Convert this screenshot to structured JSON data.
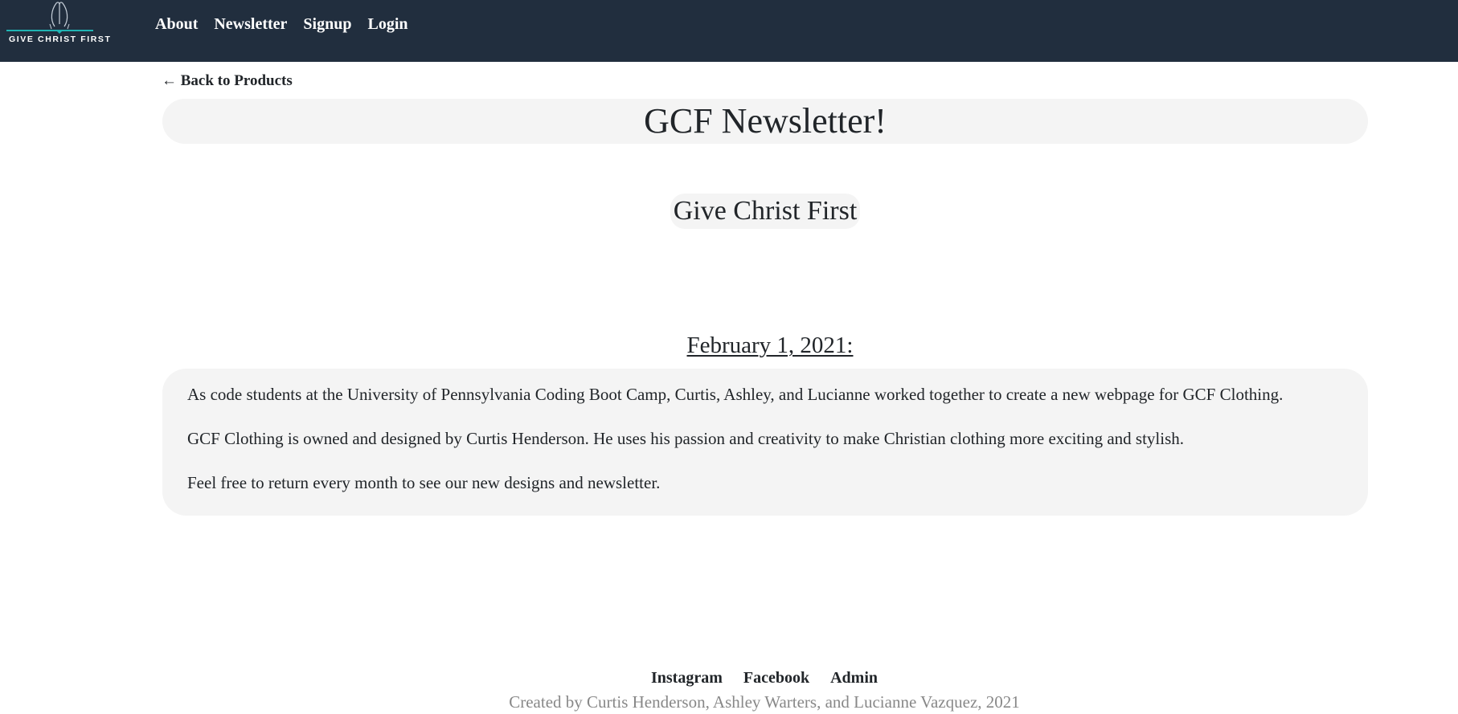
{
  "navbar": {
    "logo": {
      "text": "GIVE CHRIST FIRST",
      "icon": "praying-hands-icon",
      "accent_color": "#1fb3b3"
    },
    "links": [
      "About",
      "Newsletter",
      "Signup",
      "Login"
    ],
    "background_color": "#212e3e"
  },
  "back_link": {
    "arrow": "←",
    "label": "Back to Products"
  },
  "main": {
    "title": "GCF Newsletter!",
    "subtitle": "Give Christ First",
    "date": "February 1, 2021:",
    "paragraphs": [
      "As code students at the University of Pennsylvania Coding Boot Camp, Curtis, Ashley, and Lucianne worked together to create a new webpage for GCF Clothing.",
      "GCF Clothing is owned and designed by Curtis Henderson. He uses his passion and creativity to make Christian clothing more exciting and stylish.",
      "Feel free to return every month to see our new designs and newsletter."
    ],
    "panel_color": "#f4f4f4"
  },
  "footer": {
    "links": [
      "Instagram",
      "Facebook",
      "Admin"
    ],
    "credits": "Created by Curtis Henderson, Ashley Warters, and Lucianne Vazquez, 2021"
  }
}
